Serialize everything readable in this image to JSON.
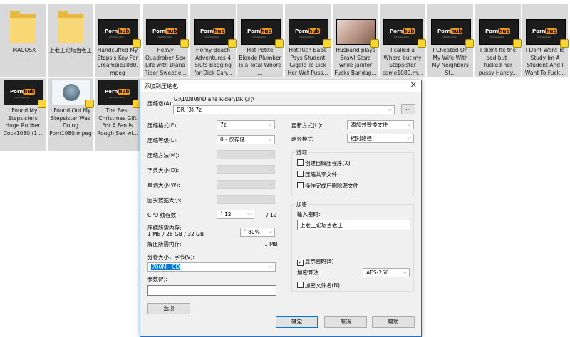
{
  "files": [
    {
      "name": "_MACOSX",
      "type": "folder"
    },
    {
      "name": "上老王论坛当老王",
      "type": "folder"
    },
    {
      "name": "Handcuffed My Stepsis Key For Creampie1080.mpeg",
      "type": "video"
    },
    {
      "name": "Heavy Quadrober Sex Life with Diana Rider Sweetie...",
      "type": "video"
    },
    {
      "name": "Horny Beach Adventures 4 Sluts Begging for Dick Can...",
      "type": "video"
    },
    {
      "name": "Hot Petite Blonde Plumber Is a Total Whore ...",
      "type": "video"
    },
    {
      "name": "Hot Rich Babe Pays Student Gigolo To Lick Her Wet Puss...",
      "type": "video"
    },
    {
      "name": "Husband plays Brawl Stars while Janitor Fucks Bandag...",
      "type": "photo"
    },
    {
      "name": "I called a Whore but my Stepsister came1080.m...",
      "type": "video"
    },
    {
      "name": "I Cheated On My Wife With My Neighbors St...",
      "type": "video"
    },
    {
      "name": "I didnt fix the bed but I fucked her pussy Handy...",
      "type": "video"
    },
    {
      "name": "I Dont Want To Study Im A Student And I Want To Fuck...",
      "type": "video"
    },
    {
      "name": "I Found My Stepsisters Huge Rubber Cock1080 (1...",
      "type": "video"
    },
    {
      "name": "I Found Out My Stepsister Was Doing Porn1080.mpeg",
      "type": "avatar"
    },
    {
      "name": "The Best Christmas Gift For A Fan Is Rough Sex wi...",
      "type": "video"
    }
  ],
  "thumb_logo": {
    "porn": "Porn",
    "hub": "hub",
    "sub": "community"
  },
  "dialog": {
    "title": "添加到压缩包",
    "close_glyph": "✕",
    "archive_label": "压缩包(A):",
    "archive_path": "G:\\1\\0808\\Diana Rider\\DR (3)\\",
    "archive_name": "DR (3).7z",
    "browse_label": "...",
    "format_label": "压缩格式(F):",
    "format_value": "7z",
    "level_label": "压缩等级(L):",
    "level_value": "0 - 仅存储",
    "method_label": "压缩方法(M):",
    "dict_label": "字典大小(D):",
    "word_label": "单词大小(W):",
    "solid_label": "固实数据大小:",
    "cpu_label": "CPU 线程数:",
    "cpu_value": "12",
    "cpu_total": "/ 12",
    "mem_comp_label": "压缩所需内存:",
    "mem_comp_value": "1 MB / 26 GB / 32 GB",
    "mem_percent": "80%",
    "mem_decomp_label": "解压所需内存:",
    "mem_decomp_value": "1 MB",
    "split_label": "分卷大小，字节(V):",
    "split_value": "700M - CD",
    "params_label": "参数(P):",
    "params_value": "",
    "options_button": "选项",
    "update_label": "更新方式(U):",
    "update_value": "添加并替换文件",
    "path_label": "路径模式",
    "path_value": "相对路径",
    "options_group": "选项",
    "opt_sfx": "创建自解压程序(X)",
    "opt_shared": "压缩共享文件",
    "opt_delete": "操作完成后删除源文件",
    "encrypt_group": "加密",
    "password_label": "输入密码:",
    "password_value": "上老王论坛当老王",
    "show_password": "显示密码(S)",
    "encrypt_method_label": "加密算法:",
    "encrypt_method_value": "AES-256",
    "encrypt_names": "加密文件名(N)",
    "ok": "确定",
    "cancel": "取消",
    "help": "帮助"
  },
  "colors": {
    "dialog_border": "#2b6cb8",
    "accent": "#0078d7",
    "folder": "#f8d775"
  }
}
